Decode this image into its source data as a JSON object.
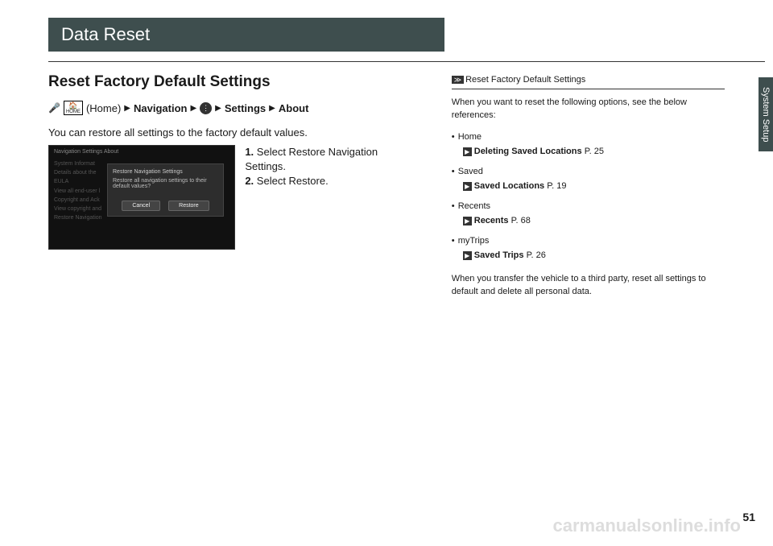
{
  "banner": "Data Reset",
  "section_title": "Reset Factory Default Settings",
  "breadcrumb": {
    "home_label": "(Home)",
    "nav": "Navigation",
    "settings": "Settings",
    "about": "About"
  },
  "intro": "You can restore all settings to the factory default values.",
  "screenshot": {
    "top": "Navigation Settings   About",
    "line1": "System Informat",
    "line2": "Details about the",
    "line3": "EULA",
    "line4": "View all end-user l",
    "line5": "Copyright and Ack",
    "line6": "View copyright and",
    "line7": "Restore Navigation",
    "dialog": {
      "title": "Restore Navigation Settings",
      "text": "Restore all navigation settings to their default values?",
      "cancel": "Cancel",
      "restore": "Restore"
    }
  },
  "steps": [
    {
      "num": "1.",
      "action": "Select ",
      "target": "Restore Navigation Settings",
      "suffix": "."
    },
    {
      "num": "2.",
      "action": "Select ",
      "target": "Restore",
      "suffix": "."
    }
  ],
  "side": {
    "header": "Reset Factory Default Settings",
    "intro": "When you want to reset the following options, see the below references:",
    "items": [
      {
        "label": "Home",
        "ref": "Deleting Saved Locations",
        "page": "P. 25"
      },
      {
        "label": "Saved",
        "ref": "Saved Locations",
        "page": "P. 19"
      },
      {
        "label": "Recents",
        "ref": "Recents",
        "page": "P. 68"
      },
      {
        "label": "myTrips",
        "ref": "Saved Trips",
        "page": "P. 26"
      }
    ],
    "outro": "When you transfer the vehicle to a third party, reset all settings to default and delete all personal data."
  },
  "side_tab": "System Setup",
  "page_number": "51",
  "watermark": "carmanualsonline.info"
}
